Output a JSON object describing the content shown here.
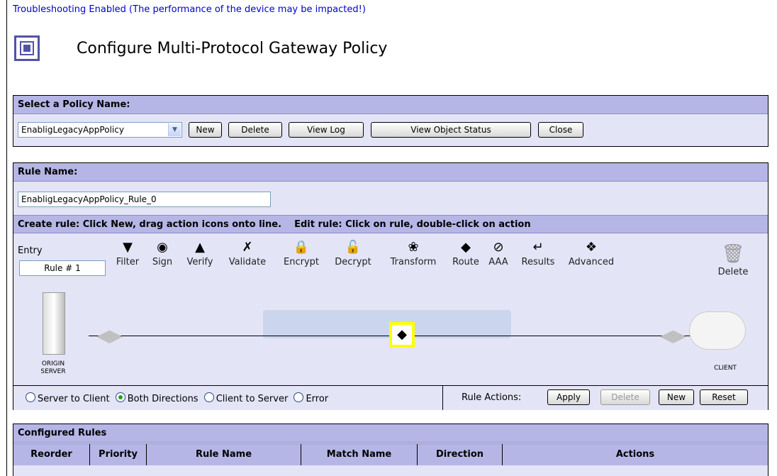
{
  "banner": "Troubleshooting Enabled (The performance of the device may be impacted!)",
  "page_title": "Configure Multi-Protocol Gateway Policy",
  "policy": {
    "header": "Select a Policy Name:",
    "selected": "EnabligLegacyAppPolicy",
    "buttons": {
      "new": "New",
      "delete": "Delete",
      "view_log": "View Log",
      "view_status": "View Object Status",
      "close": "Close"
    }
  },
  "rule": {
    "header": "Rule Name:",
    "name_value": "EnabligLegacyAppPolicy_Rule_0",
    "instructions": "Create rule: Click New, drag action icons onto line.    Edit rule: Click on rule, double-click on action",
    "entry_label": "Entry",
    "entry_value": "Rule # 1",
    "actions": [
      {
        "label": "Filter",
        "icon": "filter-icon"
      },
      {
        "label": "Sign",
        "icon": "sign-icon"
      },
      {
        "label": "Verify",
        "icon": "verify-icon"
      },
      {
        "label": "Validate",
        "icon": "validate-icon"
      },
      {
        "label": "Encrypt",
        "icon": "encrypt-icon"
      },
      {
        "label": "Decrypt",
        "icon": "decrypt-icon"
      },
      {
        "label": "Transform",
        "icon": "transform-icon"
      },
      {
        "label": "Route",
        "icon": "route-icon"
      },
      {
        "label": "AAA",
        "icon": "aaa-icon"
      },
      {
        "label": "Results",
        "icon": "results-icon"
      },
      {
        "label": "Advanced",
        "icon": "advanced-icon"
      }
    ],
    "delete_label": "Delete",
    "origin_label_1": "ORIGIN",
    "origin_label_2": "SERVER",
    "client_label": "CLIENT",
    "direction_options": [
      "Server to Client",
      "Both Directions",
      "Client to Server",
      "Error"
    ],
    "direction_selected": "Both Directions",
    "rule_actions_label": "Rule Actions:",
    "rule_buttons": {
      "apply": "Apply",
      "delete": "Delete",
      "new": "New",
      "reset": "Reset"
    }
  },
  "configured": {
    "header": "Configured Rules",
    "columns": [
      "Reorder",
      "Priority",
      "Rule Name",
      "Match Name",
      "Direction",
      "Actions"
    ]
  },
  "colors": {
    "header_bg": "#b6b6e6",
    "panel_bg": "#e4e4f7",
    "link": "#0000cc",
    "highlight": "#ffff00"
  }
}
